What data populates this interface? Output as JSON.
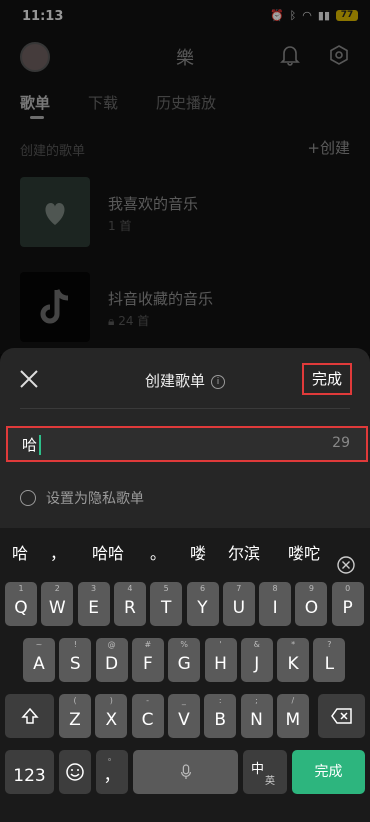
{
  "status_bar": {
    "time": "11:13",
    "battery": "77"
  },
  "header": {
    "app_title": "樂"
  },
  "tabs": [
    {
      "label": "歌单"
    },
    {
      "label": "下载"
    },
    {
      "label": "历史播放"
    }
  ],
  "section": {
    "label": "创建的歌单",
    "create_label": "+创建"
  },
  "playlists": [
    {
      "name": "我喜欢的音乐",
      "meta": "1 首"
    },
    {
      "name": "抖音收藏的音乐",
      "meta": "24 首"
    }
  ],
  "sheet": {
    "title": "创建歌单",
    "done_label": "完成",
    "input_value": "哈",
    "char_count": "29",
    "privacy_label": "设置为隐私歌单"
  },
  "keyboard": {
    "candidates": [
      "哈",
      "，",
      "哈哈",
      "。",
      "喽",
      "尔滨",
      "喽咜"
    ],
    "row1": [
      {
        "main": "Q",
        "sub": "1"
      },
      {
        "main": "W",
        "sub": "2"
      },
      {
        "main": "E",
        "sub": "3"
      },
      {
        "main": "R",
        "sub": "4"
      },
      {
        "main": "T",
        "sub": "5"
      },
      {
        "main": "Y",
        "sub": "6"
      },
      {
        "main": "U",
        "sub": "7"
      },
      {
        "main": "I",
        "sub": "8"
      },
      {
        "main": "O",
        "sub": "9"
      },
      {
        "main": "P",
        "sub": "0"
      }
    ],
    "row2": [
      {
        "main": "A",
        "sub": "~"
      },
      {
        "main": "S",
        "sub": "!"
      },
      {
        "main": "D",
        "sub": "@"
      },
      {
        "main": "F",
        "sub": "#"
      },
      {
        "main": "G",
        "sub": "%"
      },
      {
        "main": "H",
        "sub": "'"
      },
      {
        "main": "J",
        "sub": "&"
      },
      {
        "main": "K",
        "sub": "*"
      },
      {
        "main": "L",
        "sub": "?"
      }
    ],
    "row3": [
      {
        "main": "Z",
        "sub": "("
      },
      {
        "main": "X",
        "sub": ")"
      },
      {
        "main": "C",
        "sub": "-"
      },
      {
        "main": "V",
        "sub": "_"
      },
      {
        "main": "B",
        "sub": ":"
      },
      {
        "main": "N",
        "sub": ";"
      },
      {
        "main": "M",
        "sub": "/"
      }
    ],
    "numbers_label": "123",
    "comma_label": "，",
    "comma_sub": "。",
    "lang_label": "中",
    "lang_sub": "英",
    "enter_label": "完成"
  },
  "colors": {
    "accent_green": "#2db57e",
    "highlight_red": "#e03a3a"
  }
}
